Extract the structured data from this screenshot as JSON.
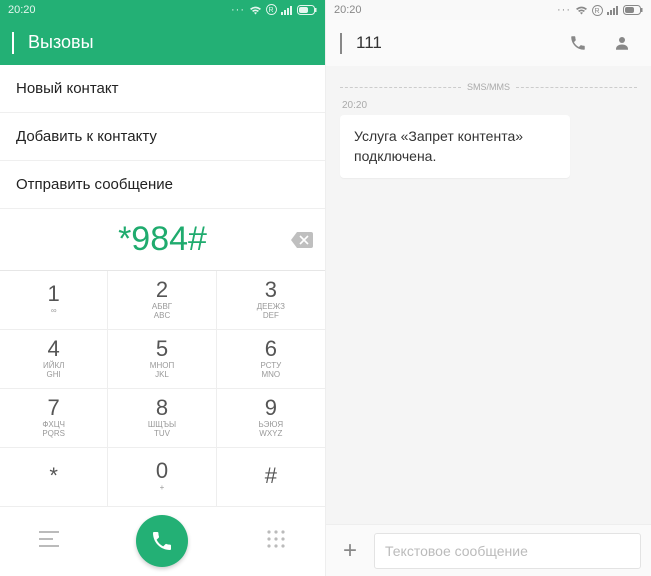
{
  "left": {
    "status_time": "20:20",
    "title": "Вызовы",
    "options": [
      "Новый контакт",
      "Добавить к контакту",
      "Отправить сообщение"
    ],
    "dialed": "*984#",
    "keys": [
      {
        "d": "1",
        "s": "∞"
      },
      {
        "d": "2",
        "s": "АБВГ\nABC"
      },
      {
        "d": "3",
        "s": "ДЕЕЖЗ\nDEF"
      },
      {
        "d": "4",
        "s": "ИЙКЛ\nGHI"
      },
      {
        "d": "5",
        "s": "МНОП\nJKL"
      },
      {
        "d": "6",
        "s": "РСТУ\nMNO"
      },
      {
        "d": "7",
        "s": "ФХЦЧ\nPQRS"
      },
      {
        "d": "8",
        "s": "ШЩЪЫ\nTUV"
      },
      {
        "d": "9",
        "s": "ЬЭЮЯ\nWXYZ"
      },
      {
        "d": "*",
        "s": ""
      },
      {
        "d": "0",
        "s": "+"
      },
      {
        "d": "#",
        "s": ""
      }
    ]
  },
  "right": {
    "status_time": "20:20",
    "contact": "111",
    "divider_label": "SMS/MMS",
    "msg_time": "20:20",
    "message": "Услуга «Запрет контента» подключена.",
    "compose_placeholder": "Текстовое сообщение"
  }
}
